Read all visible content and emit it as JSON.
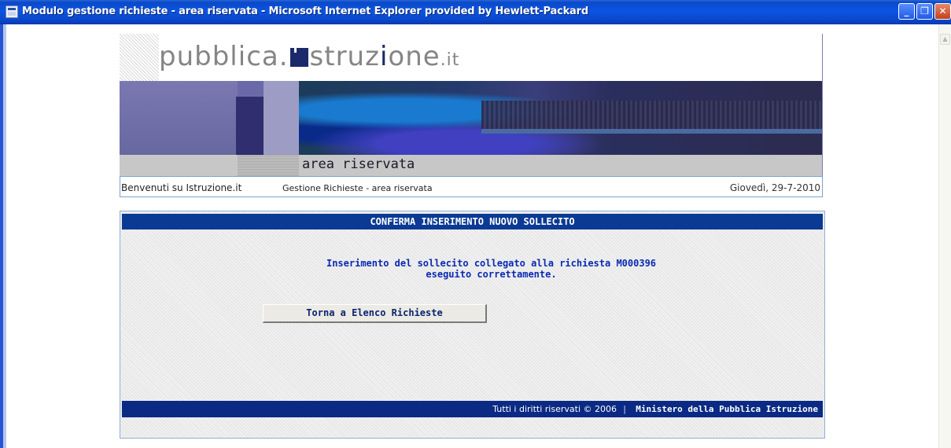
{
  "window": {
    "title": "Modulo gestione richieste - area riservata - Microsoft Internet Explorer provided by Hewlett-Packard",
    "min_glyph": "_",
    "max_glyph": "❐",
    "close_glyph": "✕"
  },
  "banner": {
    "logo_prefix": "pubblica.",
    "logo_mid": "struz",
    "logo_i": "i",
    "logo_end": "one",
    "logo_suffix": ".it",
    "area_label": "area riservata"
  },
  "infobar": {
    "welcome": "Benvenuti su Istruzione.it",
    "section": "Gestione Richieste - area riservata",
    "date": "Giovedì, 29-7-2010"
  },
  "panel": {
    "header": "CONFERMA INSERIMENTO NUOVO SOLLECITO",
    "message_line1": "Inserimento del sollecito collegato alla richiesta M000396",
    "message_line2": "eseguito correttamente.",
    "back_button": "Torna a Elenco Richieste"
  },
  "footer": {
    "rights": "Tutti i diritti riservati © 2006",
    "separator": "|",
    "ministry": "Ministero della Pubblica Istruzione"
  },
  "colors": {
    "titlebar": "#0b54e3",
    "panel_header": "#0a3a94",
    "message_text": "#0a2ab4",
    "footer": "#0a2a84"
  }
}
